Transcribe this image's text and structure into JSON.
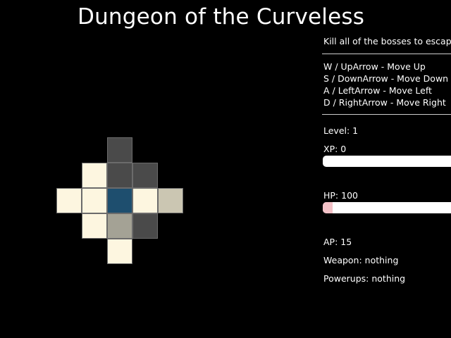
{
  "title": "Dungeon of the Curveless",
  "instructions": {
    "goal": "Kill all of the bosses to escape.",
    "controls": [
      "W / UpArrow - Move Up",
      "S / DownArrow - Move Down",
      "A / LeftArrow - Move Left",
      "D / RightArrow - Move Right"
    ]
  },
  "stats": {
    "level": "Level: 1",
    "xp": "XP: 0",
    "xp_fraction": 0.0,
    "hp": "HP: 100",
    "hp_fraction": 0.07,
    "ap": "AP: 15",
    "weapon": "Weapon: nothing",
    "powerups": "Powerups: nothing"
  },
  "colors": {
    "player": "#1e4e6e",
    "floor": "#fdf6e0",
    "wall": "#4a4a4a",
    "dim_floor": "#cbc6b2",
    "item": "#a4a295",
    "hp_bar": "#f4c2c8",
    "xp_bar": "#ffffff"
  },
  "map": {
    "legend": {
      "P": "player",
      "F": "floor",
      "W": "wall",
      "D": "dim_floor",
      "I": "item"
    },
    "rows": [
      "..W..",
      ".FWW.",
      "FFPFD",
      ".FIW.",
      "..F.."
    ]
  }
}
